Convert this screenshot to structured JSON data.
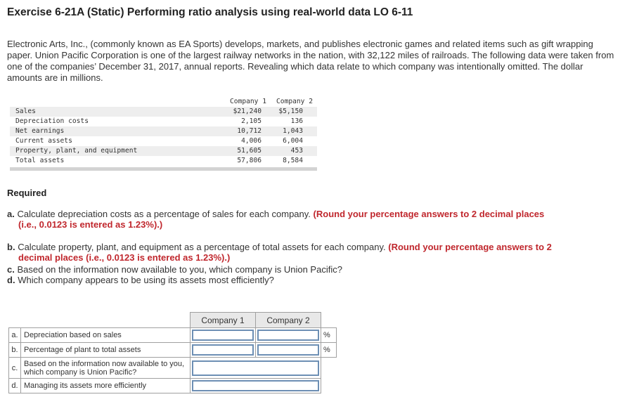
{
  "title": "Exercise 6-21A (Static) Performing ratio analysis using real-world data LO 6-11",
  "intro": "Electronic Arts, Inc., (commonly known as EA Sports) develops, markets, and publishes electronic games and related items such as gift wrapping paper. Union Pacific Corporation is one of the largest railway networks in the nation, with 32,122 miles of railroads. The following data were taken from one of the companies’ December 31, 2017, annual reports. Revealing which data relate to which company was intentionally omitted. The dollar amounts are in millions.",
  "data_table": {
    "headers": [
      "Company 1",
      "Company 2"
    ],
    "rows": [
      {
        "label": "Sales",
        "c1": "$21,240",
        "c2": "$5,150"
      },
      {
        "label": "Depreciation costs",
        "c1": "2,105",
        "c2": "136"
      },
      {
        "label": "Net earnings",
        "c1": "10,712",
        "c2": "1,043"
      },
      {
        "label": "Current assets",
        "c1": "4,006",
        "c2": "6,004"
      },
      {
        "label": "Property, plant, and equipment",
        "c1": "51,605",
        "c2": "453"
      },
      {
        "label": "Total assets",
        "c1": "57,806",
        "c2": "8,584"
      }
    ]
  },
  "required": {
    "heading": "Required",
    "a": {
      "letter": "a.",
      "text": "Calculate depreciation costs as a percentage of sales for each company.",
      "note": "(Round your percentage answers to 2 decimal places",
      "note2": "(i.e., 0.0123 is entered as 1.23%).)"
    },
    "b": {
      "letter": "b.",
      "text": "Calculate property, plant, and equipment as a percentage of total assets for each company.",
      "note": "(Round your percentage answers to 2",
      "note2": "decimal places (i.e., 0.0123 is entered as 1.23%).)"
    },
    "c": {
      "letter": "c.",
      "text": "Based on the information now available to you, which company is Union Pacific?"
    },
    "d": {
      "letter": "d.",
      "text": "Which company appears to be using its assets most efficiently?"
    }
  },
  "answer_table": {
    "headers": [
      "Company 1",
      "Company 2"
    ],
    "rows": [
      {
        "letter": "a.",
        "desc": "Depreciation  based on sales",
        "unit": "%",
        "c1": "",
        "c2": ""
      },
      {
        "letter": "b.",
        "desc": "Percentage of plant to total assets",
        "unit": "%",
        "c1": "",
        "c2": ""
      },
      {
        "letter": "c.",
        "desc": "Based on the information now available to you, which company is Union Pacific?",
        "answer": ""
      },
      {
        "letter": "d.",
        "desc": "Managing its assets more efficiently",
        "answer": ""
      }
    ]
  }
}
